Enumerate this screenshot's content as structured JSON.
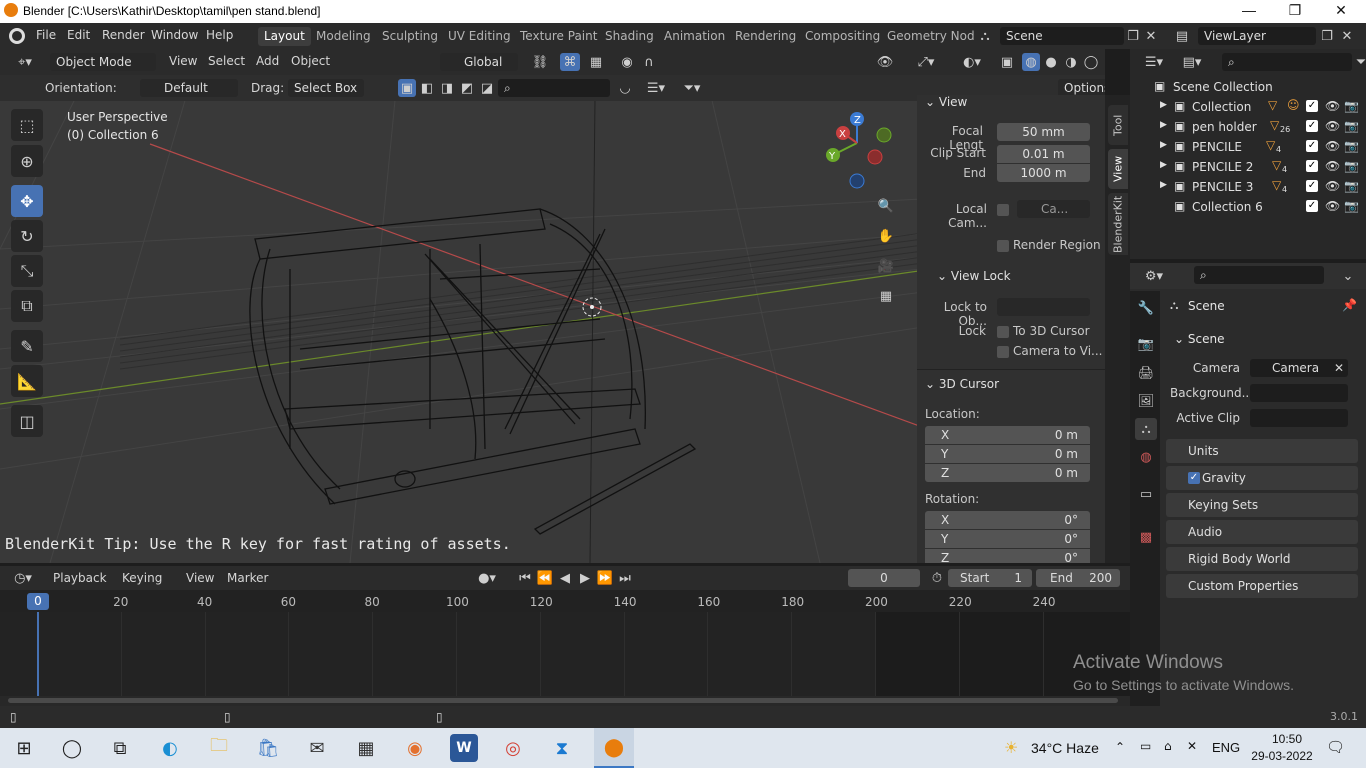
{
  "window": {
    "title": "Blender [C:\\Users\\Kathir\\Desktop\\tamil\\pen stand.blend]",
    "minimize": "—",
    "maximize": "❐",
    "close": "✕"
  },
  "menu": [
    "File",
    "Edit",
    "Render",
    "Window",
    "Help"
  ],
  "workspaces": [
    "Layout",
    "Modeling",
    "Sculpting",
    "UV Editing",
    "Texture Paint",
    "Shading",
    "Animation",
    "Rendering",
    "Compositing",
    "Geometry Nod"
  ],
  "scene_field": "Scene",
  "viewlayer_field": "ViewLayer",
  "viewport": {
    "mode": "Object Mode",
    "menus": [
      "View",
      "Select",
      "Add",
      "Object"
    ],
    "transform": "Global",
    "orientation_label": "Orientation:",
    "orientation_value": "Default",
    "drag_label": "Drag:",
    "drag_value": "Select Box",
    "options": "Options",
    "info_line1": "User Perspective",
    "info_line2": "(0) Collection 6",
    "tip": "BlenderKit Tip: Use the R key for fast rating of assets.",
    "gizmo": {
      "x": "X",
      "y": "Y",
      "z": "Z"
    }
  },
  "npanel": {
    "view_header": "View",
    "focal_label": "Focal Lengt",
    "focal_value": "50 mm",
    "clip_start_label": "Clip Start",
    "clip_start_value": "0.01 m",
    "end_label": "End",
    "end_value": "1000 m",
    "local_cam_label": "Local Cam...",
    "local_cam_value": "Ca...",
    "render_region": "Render Region",
    "view_lock_header": "View Lock",
    "lock_to_obj_label": "Lock to Ob...",
    "lock_label": "Lock",
    "to_3d_cursor": "To 3D Cursor",
    "camera_to_view": "Camera to Vi...",
    "cursor_header": "3D Cursor",
    "location_label": "Location:",
    "loc_x_label": "X",
    "loc_x": "0 m",
    "loc_y_label": "Y",
    "loc_y": "0 m",
    "loc_z_label": "Z",
    "loc_z": "0 m",
    "rotation_label": "Rotation:",
    "rot_x_label": "X",
    "rot_x": "0°",
    "rot_y_label": "Y",
    "rot_y": "0°",
    "rot_z_label": "Z",
    "rot_z": "0°",
    "tabs": [
      "Tool",
      "View",
      "BlenderKit"
    ]
  },
  "outliner": {
    "root": "Scene Collection",
    "items": [
      {
        "name": "Collection",
        "badge": ""
      },
      {
        "name": "pen holder",
        "badge": "26"
      },
      {
        "name": "PENCILE",
        "badge": "4"
      },
      {
        "name": "PENCILE 2",
        "badge": "4"
      },
      {
        "name": "PENCILE 3",
        "badge": "4"
      },
      {
        "name": "Collection 6",
        "badge": ""
      }
    ]
  },
  "properties": {
    "title": "Scene",
    "scene_section": "Scene",
    "camera_label": "Camera",
    "camera_value": "Camera",
    "background_label": "Background...",
    "active_clip_label": "Active Clip",
    "sections": [
      "Units",
      "Gravity",
      "Keying Sets",
      "Audio",
      "Rigid Body World",
      "Custom Properties"
    ]
  },
  "timeline": {
    "menus": [
      "Playback",
      "Keying",
      "View",
      "Marker"
    ],
    "current_frame": "0",
    "start_label": "Start",
    "start": "1",
    "end_label": "End",
    "end": "200",
    "ticks": [
      "0",
      "20",
      "40",
      "60",
      "80",
      "100",
      "120",
      "140",
      "160",
      "180",
      "200",
      "220",
      "240"
    ]
  },
  "watermark": {
    "line1": "Activate Windows",
    "line2": "Go to Settings to activate Windows."
  },
  "status": {
    "version": "3.0.1"
  },
  "taskbar": {
    "weather": "34°C  Haze",
    "lang": "ENG",
    "time": "10:50",
    "date": "29-03-2022"
  }
}
